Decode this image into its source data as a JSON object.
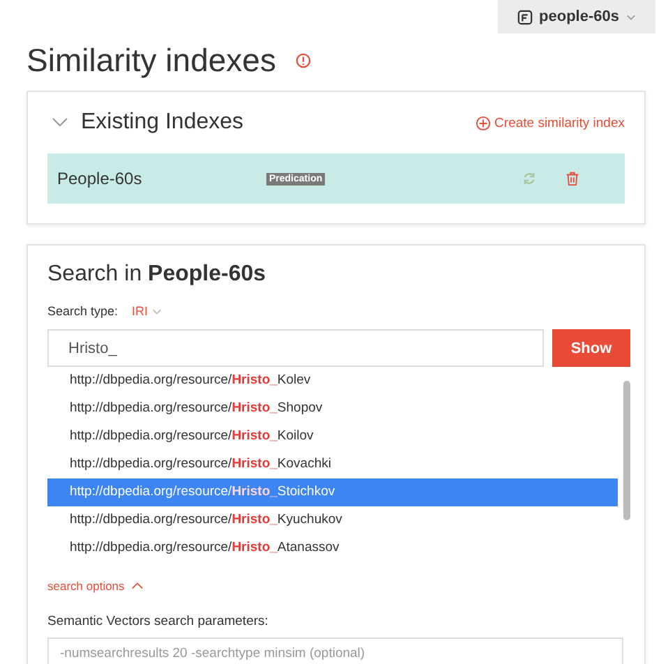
{
  "repository": {
    "label": "people-60s"
  },
  "title": "Similarity indexes",
  "existing": {
    "heading": "Existing Indexes",
    "expanded": true,
    "create_link": "Create similarity index",
    "indexes": [
      {
        "name": "People-60s",
        "tag": "Predication",
        "selected": true
      }
    ]
  },
  "search": {
    "heading_prefix": "Search in",
    "heading_name": "People-60s",
    "type_label": "Search type:",
    "type_value": "IRI",
    "query": "Hristo_",
    "show_button": "Show",
    "suggestions": [
      {
        "prefix": "http://dbpedia.org/resource/",
        "match": "Hristo_",
        "rest": "Kolev",
        "selected": false
      },
      {
        "prefix": "http://dbpedia.org/resource/",
        "match": "Hristo_",
        "rest": "Shopov",
        "selected": false
      },
      {
        "prefix": "http://dbpedia.org/resource/",
        "match": "Hristo_",
        "rest": "Koilov",
        "selected": false
      },
      {
        "prefix": "http://dbpedia.org/resource/",
        "match": "Hristo_",
        "rest": "Kovachki",
        "selected": false
      },
      {
        "prefix": "http://dbpedia.org/resource/",
        "match": "Hristo_",
        "rest": "Stoichkov",
        "selected": true
      },
      {
        "prefix": "http://dbpedia.org/resource/",
        "match": "Hristo_",
        "rest": "Kyuchukov",
        "selected": false
      },
      {
        "prefix": "http://dbpedia.org/resource/",
        "match": "Hristo_",
        "rest": "Atanassov",
        "selected": false
      }
    ],
    "options_link": "search options",
    "options_expanded": true,
    "params_label": "Semantic Vectors search parameters:",
    "params_placeholder": "-numsearchresults 20 -searchtype minsim (optional)"
  }
}
